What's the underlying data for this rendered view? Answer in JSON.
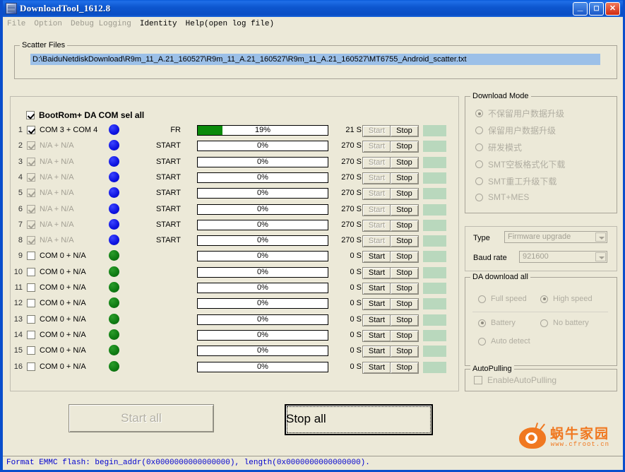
{
  "window": {
    "title": "DownloadTool_1612.8",
    "icon": "app-icon",
    "minimize_label": "_",
    "maximize_label": "❐",
    "close_label": "✕"
  },
  "menu": {
    "items": [
      {
        "label": "File",
        "enabled": false
      },
      {
        "label": "Option",
        "enabled": false
      },
      {
        "label": "Debug Logging",
        "enabled": false
      },
      {
        "label": "Identity",
        "enabled": true
      },
      {
        "label": "Help(open log file)",
        "enabled": true
      }
    ]
  },
  "scatter": {
    "legend": "Scatter Files",
    "path": "D:\\BaiduNetdiskDownload\\R9m_11_A.21_160527\\R9m_11_A.21_160527\\R9m_11_A.21_160527\\MT6755_Android_scatter.txt"
  },
  "device_panel": {
    "select_all_label": "BootRom+ DA COM sel all",
    "select_all_checked": true,
    "start_button_label": "Start",
    "stop_button_label": "Stop",
    "rows": [
      {
        "num": "1",
        "com": "COM 3 + COM 4",
        "checked": true,
        "enabled": true,
        "led": "blue",
        "start_label": "FR",
        "percent": "19%",
        "percent_value": 19,
        "seconds": "21 S",
        "start_enabled": false,
        "stop_enabled": true
      },
      {
        "num": "2",
        "com": "N/A + N/A",
        "checked": true,
        "enabled": false,
        "led": "blue",
        "start_label": "START",
        "percent": "0%",
        "percent_value": 0,
        "seconds": "270 S",
        "start_enabled": false,
        "stop_enabled": true
      },
      {
        "num": "3",
        "com": "N/A + N/A",
        "checked": true,
        "enabled": false,
        "led": "blue",
        "start_label": "START",
        "percent": "0%",
        "percent_value": 0,
        "seconds": "270 S",
        "start_enabled": false,
        "stop_enabled": true
      },
      {
        "num": "4",
        "com": "N/A + N/A",
        "checked": true,
        "enabled": false,
        "led": "blue",
        "start_label": "START",
        "percent": "0%",
        "percent_value": 0,
        "seconds": "270 S",
        "start_enabled": false,
        "stop_enabled": true
      },
      {
        "num": "5",
        "com": "N/A + N/A",
        "checked": true,
        "enabled": false,
        "led": "blue",
        "start_label": "START",
        "percent": "0%",
        "percent_value": 0,
        "seconds": "270 S",
        "start_enabled": false,
        "stop_enabled": true
      },
      {
        "num": "6",
        "com": "N/A + N/A",
        "checked": true,
        "enabled": false,
        "led": "blue",
        "start_label": "START",
        "percent": "0%",
        "percent_value": 0,
        "seconds": "270 S",
        "start_enabled": false,
        "stop_enabled": true
      },
      {
        "num": "7",
        "com": "N/A + N/A",
        "checked": true,
        "enabled": false,
        "led": "blue",
        "start_label": "START",
        "percent": "0%",
        "percent_value": 0,
        "seconds": "270 S",
        "start_enabled": false,
        "stop_enabled": true
      },
      {
        "num": "8",
        "com": "N/A + N/A",
        "checked": true,
        "enabled": false,
        "led": "blue",
        "start_label": "START",
        "percent": "0%",
        "percent_value": 0,
        "seconds": "270 S",
        "start_enabled": false,
        "stop_enabled": true
      },
      {
        "num": "9",
        "com": "COM 0 + N/A",
        "checked": false,
        "enabled": true,
        "led": "green",
        "start_label": "",
        "percent": "0%",
        "percent_value": 0,
        "seconds": "0 S",
        "start_enabled": true,
        "stop_enabled": true
      },
      {
        "num": "10",
        "com": "COM 0 + N/A",
        "checked": false,
        "enabled": true,
        "led": "green",
        "start_label": "",
        "percent": "0%",
        "percent_value": 0,
        "seconds": "0 S",
        "start_enabled": true,
        "stop_enabled": true
      },
      {
        "num": "11",
        "com": "COM 0 + N/A",
        "checked": false,
        "enabled": true,
        "led": "green",
        "start_label": "",
        "percent": "0%",
        "percent_value": 0,
        "seconds": "0 S",
        "start_enabled": true,
        "stop_enabled": true
      },
      {
        "num": "12",
        "com": "COM 0 + N/A",
        "checked": false,
        "enabled": true,
        "led": "green",
        "start_label": "",
        "percent": "0%",
        "percent_value": 0,
        "seconds": "0 S",
        "start_enabled": true,
        "stop_enabled": true
      },
      {
        "num": "13",
        "com": "COM 0 + N/A",
        "checked": false,
        "enabled": true,
        "led": "green",
        "start_label": "",
        "percent": "0%",
        "percent_value": 0,
        "seconds": "0 S",
        "start_enabled": true,
        "stop_enabled": true
      },
      {
        "num": "14",
        "com": "COM 0 + N/A",
        "checked": false,
        "enabled": true,
        "led": "green",
        "start_label": "",
        "percent": "0%",
        "percent_value": 0,
        "seconds": "0 S",
        "start_enabled": true,
        "stop_enabled": true
      },
      {
        "num": "15",
        "com": "COM 0 + N/A",
        "checked": false,
        "enabled": true,
        "led": "green",
        "start_label": "",
        "percent": "0%",
        "percent_value": 0,
        "seconds": "0 S",
        "start_enabled": true,
        "stop_enabled": true
      },
      {
        "num": "16",
        "com": "COM 0 + N/A",
        "checked": false,
        "enabled": true,
        "led": "green",
        "start_label": "",
        "percent": "0%",
        "percent_value": 0,
        "seconds": "0 S",
        "start_enabled": true,
        "stop_enabled": true
      }
    ]
  },
  "download_mode": {
    "legend": "Download Mode",
    "options": [
      {
        "label": "不保留用户数据升级",
        "selected": true
      },
      {
        "label": "保留用户数据升级",
        "selected": false
      },
      {
        "label": "研发模式",
        "selected": false
      },
      {
        "label": "SMT空板格式化下载",
        "selected": false
      },
      {
        "label": "SMT重工升级下载",
        "selected": false
      },
      {
        "label": "SMT+MES",
        "selected": false
      }
    ]
  },
  "type_box": {
    "type_label": "Type",
    "type_value": "Firmware upgrade",
    "baud_label": "Baud rate",
    "baud_value": "921600"
  },
  "da_download": {
    "legend": "DA download all",
    "speed_options": [
      {
        "label": "Full speed",
        "selected": false
      },
      {
        "label": "High speed",
        "selected": true
      }
    ],
    "battery_options": [
      {
        "label": "Battery",
        "selected": true
      },
      {
        "label": "No battery",
        "selected": false
      },
      {
        "label": "Auto detect",
        "selected": false
      }
    ]
  },
  "auto_pulling": {
    "legend": "AutoPulling",
    "checkbox_label": "EnableAutoPulling",
    "checked": false
  },
  "footer": {
    "start_all_label": "Start all",
    "start_all_enabled": false,
    "stop_all_label": "Stop all",
    "stop_all_enabled": true
  },
  "status_bar": {
    "text": "Format EMMC flash:  begin_addr(0x0000000000000000), length(0x0000000000000000)."
  },
  "logo": {
    "brand_cn": "蜗牛家园",
    "url": "www.cfroot.cn"
  },
  "colors": {
    "titlebar": "#0a4ec4",
    "background": "#ece9d8",
    "progress_fill": "#0a8a0a",
    "led_blue": "#0d12e0",
    "led_green": "#0e7a12",
    "status_text": "#0000cf",
    "selection": "#9cc0e8",
    "brand_orange": "#f07820"
  }
}
